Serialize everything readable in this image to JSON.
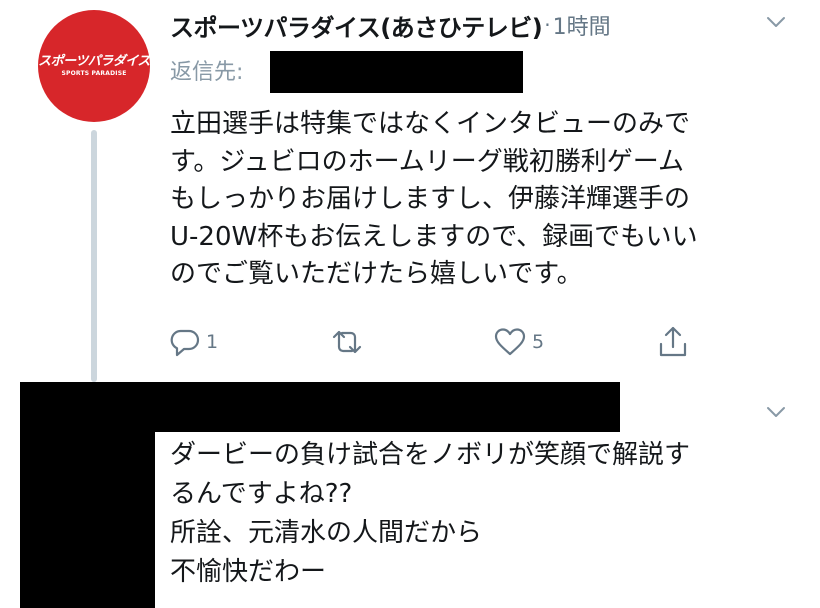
{
  "tweet": {
    "avatar": {
      "logo_text": "スポーツパラダイス",
      "logo_subtext": "SPORTS PARADISE",
      "color": "#d7262a"
    },
    "display_name": "スポーツパラダイス(あさひテレビ)",
    "separator": "·",
    "time": "1時間",
    "reply_to_label": "返信先:",
    "text_lines": [
      "立田選手は特集ではなくインタビューのみで",
      "す。ジュビロのホームリーグ戦初勝利ゲーム",
      "もしっかりお届けしますし、伊藤洋輝選手の",
      "U-20W杯もお伝えしますので、録画でもいい",
      "のでご覧いただけたら嬉しいです。"
    ],
    "actions": {
      "reply_count": "1",
      "retweet_count": "",
      "like_count": "5"
    }
  },
  "reply": {
    "text_lines": [
      "ダービーの負け試合をノボリが笑顔で解説す",
      "るんですよね??",
      "所詮、元清水の人間だから",
      "不愉快だわー"
    ]
  },
  "icons": {
    "caret": "chevron-down-icon",
    "reply": "reply-icon",
    "retweet": "retweet-icon",
    "like": "heart-icon",
    "share": "share-icon"
  },
  "colors": {
    "text_primary": "#14171a",
    "text_secondary": "#657786",
    "thread_line": "#ccd6dd",
    "redaction": "#000000"
  }
}
